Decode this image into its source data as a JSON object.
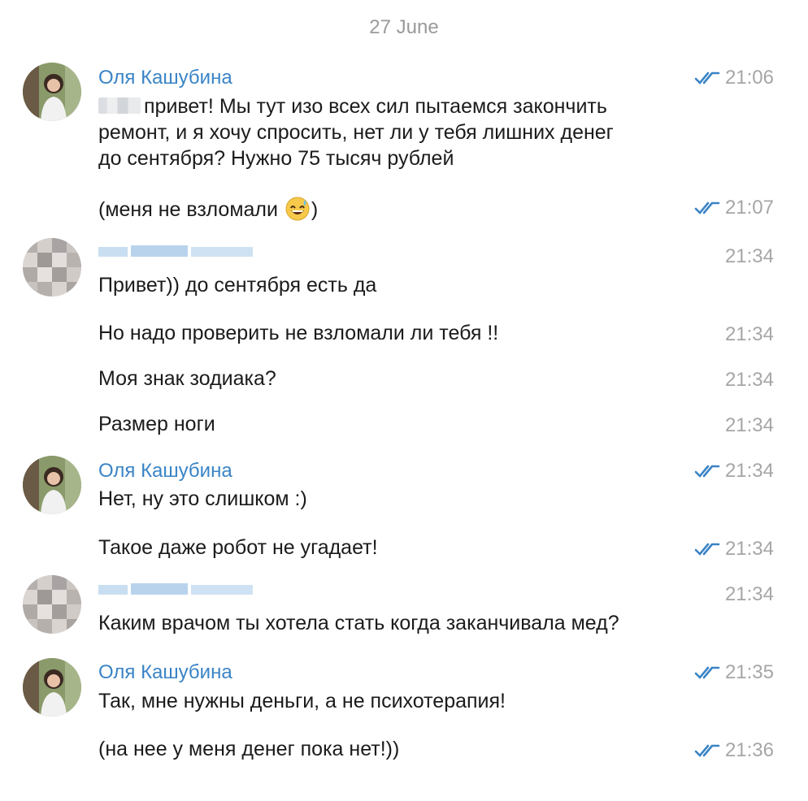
{
  "date_separator": "27 June",
  "sender_name": "Оля Кашубина",
  "messages": [
    {
      "text_after_blur": "привет! Мы тут изо всех сил пытаемся закончить",
      "line2": "ремонт, и я хочу спросить, нет ли у тебя лишних денег",
      "line3": "до сентября? Нужно 75 тысяч рублей",
      "time": "21:06"
    },
    {
      "text": "(меня не взломали",
      "text_end": ")",
      "emoji": "grinning-sweat-emoji",
      "time": "21:07"
    },
    {
      "text": "Привет)) до сентября есть да",
      "time": "21:34"
    },
    {
      "text": "Но надо проверить не взломали ли тебя !!",
      "time": "21:34"
    },
    {
      "text": "Моя знак зодиака?",
      "time": "21:34"
    },
    {
      "text": "Размер ноги",
      "time": "21:34"
    },
    {
      "text": "Нет, ну это слишком :)",
      "time": "21:34"
    },
    {
      "text": "Такое даже робот не угадает!",
      "time": "21:34"
    },
    {
      "text": "Каким врачом ты хотела стать когда заканчивала мед?",
      "time": "21:34"
    },
    {
      "text": "Так, мне нужны деньги, а не психотерапия!",
      "time": "21:35"
    },
    {
      "text": "(на нее у меня денег пока нет!))",
      "time": "21:36"
    }
  ],
  "colors": {
    "name": "#3a84c6",
    "time": "#a6a6a6",
    "ticks": "#3a84c6",
    "text": "#1b1b1b"
  },
  "icons": {
    "read_status": "double-check-icon",
    "avatar_self": "avatar-photo",
    "avatar_other": "pixelated-avatar"
  }
}
